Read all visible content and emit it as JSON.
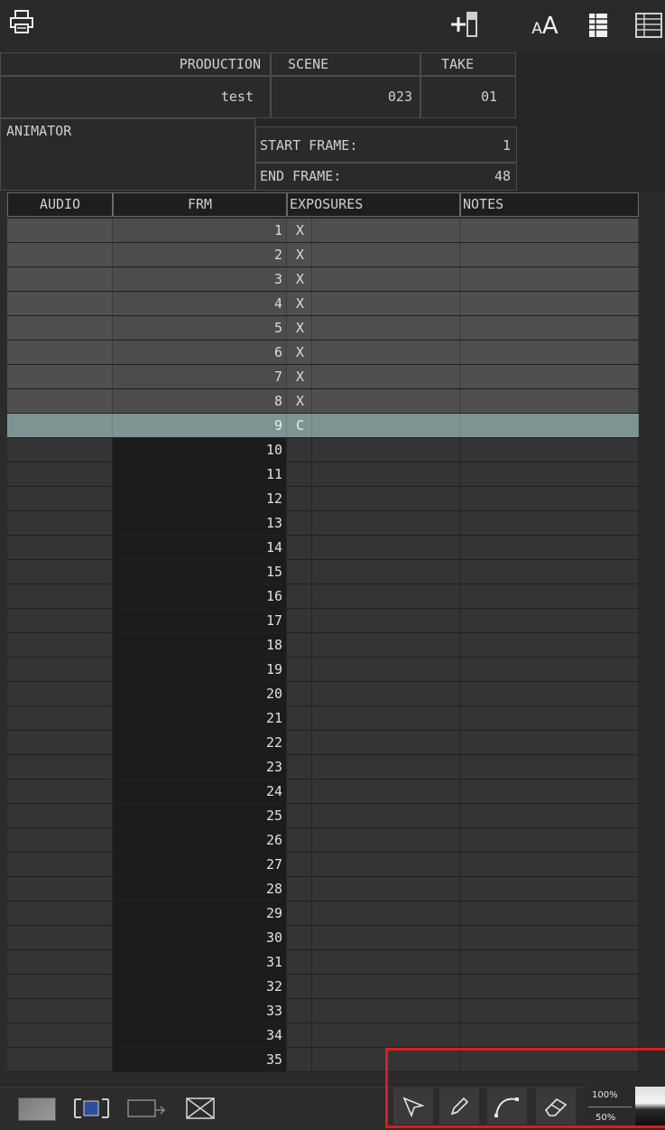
{
  "toolbar": {
    "print_icon": "printer-icon",
    "add_frame_icon": "add-frame-icon",
    "font_size_label": "AA",
    "font_size_small": "A",
    "font_size_large": "A",
    "grid_icon": "grid-view-icon",
    "table_icon": "table-view-icon"
  },
  "header": {
    "production_label": "PRODUCTION",
    "production_value": "test",
    "scene_label": "SCENE",
    "scene_value": "023",
    "take_label": "TAKE",
    "take_value": "01",
    "animator_label": "ANIMATOR",
    "start_frame_label": "START FRAME:",
    "start_frame_value": "1",
    "end_frame_label": "END FRAME:",
    "end_frame_value": "48"
  },
  "table": {
    "columns": [
      "AUDIO",
      "FRM",
      "EXPOSURES",
      "NOTES"
    ],
    "rows": [
      {
        "frm": "1",
        "exp": "X",
        "state": "filled"
      },
      {
        "frm": "2",
        "exp": "X",
        "state": "filled"
      },
      {
        "frm": "3",
        "exp": "X",
        "state": "filled"
      },
      {
        "frm": "4",
        "exp": "X",
        "state": "filled"
      },
      {
        "frm": "5",
        "exp": "X",
        "state": "filled"
      },
      {
        "frm": "6",
        "exp": "X",
        "state": "filled"
      },
      {
        "frm": "7",
        "exp": "X",
        "state": "filled"
      },
      {
        "frm": "8",
        "exp": "X",
        "state": "filled"
      },
      {
        "frm": "9",
        "exp": "C",
        "state": "current"
      },
      {
        "frm": "10",
        "exp": "",
        "state": "empty"
      },
      {
        "frm": "11",
        "exp": "",
        "state": "empty"
      },
      {
        "frm": "12",
        "exp": "",
        "state": "empty"
      },
      {
        "frm": "13",
        "exp": "",
        "state": "empty"
      },
      {
        "frm": "14",
        "exp": "",
        "state": "empty"
      },
      {
        "frm": "15",
        "exp": "",
        "state": "empty"
      },
      {
        "frm": "16",
        "exp": "",
        "state": "empty"
      },
      {
        "frm": "17",
        "exp": "",
        "state": "empty"
      },
      {
        "frm": "18",
        "exp": "",
        "state": "empty"
      },
      {
        "frm": "19",
        "exp": "",
        "state": "empty"
      },
      {
        "frm": "20",
        "exp": "",
        "state": "empty"
      },
      {
        "frm": "21",
        "exp": "",
        "state": "empty"
      },
      {
        "frm": "22",
        "exp": "",
        "state": "empty"
      },
      {
        "frm": "23",
        "exp": "",
        "state": "empty"
      },
      {
        "frm": "24",
        "exp": "",
        "state": "empty"
      },
      {
        "frm": "25",
        "exp": "",
        "state": "empty"
      },
      {
        "frm": "26",
        "exp": "",
        "state": "empty"
      },
      {
        "frm": "27",
        "exp": "",
        "state": "empty"
      },
      {
        "frm": "28",
        "exp": "",
        "state": "empty"
      },
      {
        "frm": "29",
        "exp": "",
        "state": "empty"
      },
      {
        "frm": "30",
        "exp": "",
        "state": "empty"
      },
      {
        "frm": "31",
        "exp": "",
        "state": "empty"
      },
      {
        "frm": "32",
        "exp": "",
        "state": "empty"
      },
      {
        "frm": "33",
        "exp": "",
        "state": "empty"
      },
      {
        "frm": "34",
        "exp": "",
        "state": "empty"
      },
      {
        "frm": "35",
        "exp": "",
        "state": "empty"
      }
    ]
  },
  "bottom_bar": {
    "left_icons": [
      "gradient-swatch-icon",
      "frame-fit-icon",
      "frame-export-icon",
      "clear-frame-icon"
    ],
    "tools": [
      "select-arrow-icon",
      "pencil-icon",
      "curve-icon",
      "eraser-icon"
    ],
    "zoom_top": "100%",
    "zoom_bottom": "50%"
  },
  "colors": {
    "current_row": "#7d9493",
    "highlight_box": "#e01b1b",
    "zoom_swatch_dark": "#111111",
    "zoom_swatch_light": "#f2f2f2"
  }
}
